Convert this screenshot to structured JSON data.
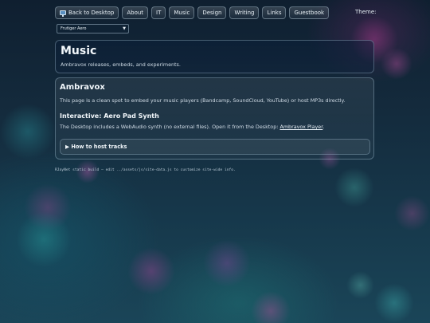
{
  "nav": {
    "desktop_label": "Back to Desktop",
    "items": [
      "About",
      "IT",
      "Music",
      "Design",
      "Writing",
      "Links",
      "Guestbook"
    ]
  },
  "theme": {
    "label": "Theme:",
    "selected": "Frutiger Aero"
  },
  "header": {
    "title": "Music",
    "subtitle": "Ambravox releases, embeds, and experiments."
  },
  "ambravox": {
    "title": "Ambravox",
    "text": "This page is a clean spot to embed your music players (Bandcamp, SoundCloud, YouTube) or host MP3s directly.",
    "synth_title": "Interactive: Aero Pad Synth",
    "synth_text": "The Desktop includes a WebAudio synth (no external files). Open it from the Desktop: ",
    "synth_link": "Ambravox Player",
    "synth_end": ".",
    "details_label": "▶ How to host tracks"
  },
  "footer": {
    "text": "RJayNet static build — edit ../assets/js/site-data.js to customize site-wide info."
  },
  "colors": {
    "background_top": "#0f1f30",
    "background_bottom": "#1a4558",
    "text": "#dfe8ef"
  }
}
